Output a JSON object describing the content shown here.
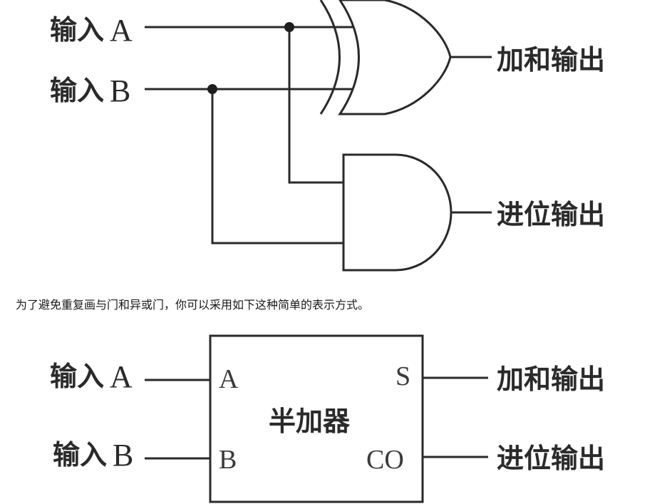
{
  "diagram1": {
    "input_a": {
      "cn": "输入",
      "letter": "A"
    },
    "input_b": {
      "cn": "输入",
      "letter": "B"
    },
    "sum_output": "加和输出",
    "carry_output": "进位输出"
  },
  "caption": "为了避免重复画与门和异或门，你可以采用如下这种简单的表示方式。",
  "diagram2": {
    "input_a": {
      "cn": "输入",
      "letter": "A"
    },
    "input_b": {
      "cn": "输入",
      "letter": "B"
    },
    "block_title": "半加器",
    "pins": {
      "a": "A",
      "b": "B",
      "s": "S",
      "co": "CO"
    },
    "sum_output": "加和输出",
    "carry_output": "进位输出"
  },
  "colors": {
    "line": "#2a2a2a",
    "text": "#2a2a2a",
    "background": "#ffffff"
  }
}
